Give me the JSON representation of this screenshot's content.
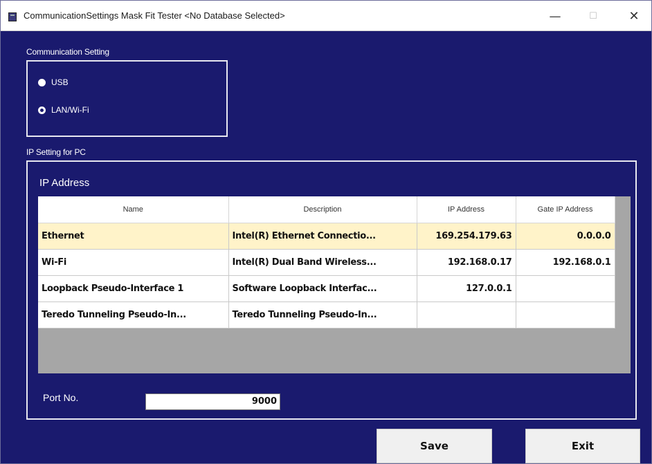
{
  "window": {
    "title": "CommunicationSettings Mask Fit Tester <No Database Selected>",
    "minimize_glyph": "—",
    "maximize_glyph": "☐",
    "close_glyph": "✕"
  },
  "communication": {
    "group_label": "Communication Setting",
    "options": [
      {
        "label": "USB",
        "selected": false
      },
      {
        "label": "LAN/Wi-Fi",
        "selected": true
      }
    ]
  },
  "ip_setting": {
    "group_label": "IP Setting for PC",
    "section_title": "IP Address",
    "columns": [
      "Name",
      "Description",
      "IP Address",
      "Gate IP Address"
    ],
    "rows": [
      {
        "name": "Ethernet",
        "description": "Intel(R) Ethernet Connectio...",
        "ip": "169.254.179.63",
        "gate": "0.0.0.0"
      },
      {
        "name": "Wi-Fi",
        "description": "Intel(R) Dual Band Wireless...",
        "ip": "192.168.0.17",
        "gate": "192.168.0.1"
      },
      {
        "name": "Loopback Pseudo-Interface 1",
        "description": "Software Loopback Interfac...",
        "ip": "127.0.0.1",
        "gate": ""
      },
      {
        "name": "Teredo Tunneling Pseudo-In...",
        "description": "Teredo Tunneling Pseudo-In...",
        "ip": "",
        "gate": ""
      }
    ],
    "selected_row": 0,
    "port_label": "Port No.",
    "port_value": "9000"
  },
  "buttons": {
    "save": "Save",
    "exit": "Exit"
  },
  "colors": {
    "background": "#1a1a6e",
    "selected_row": "#fff3c9",
    "grid_empty": "#a6a6a6"
  }
}
